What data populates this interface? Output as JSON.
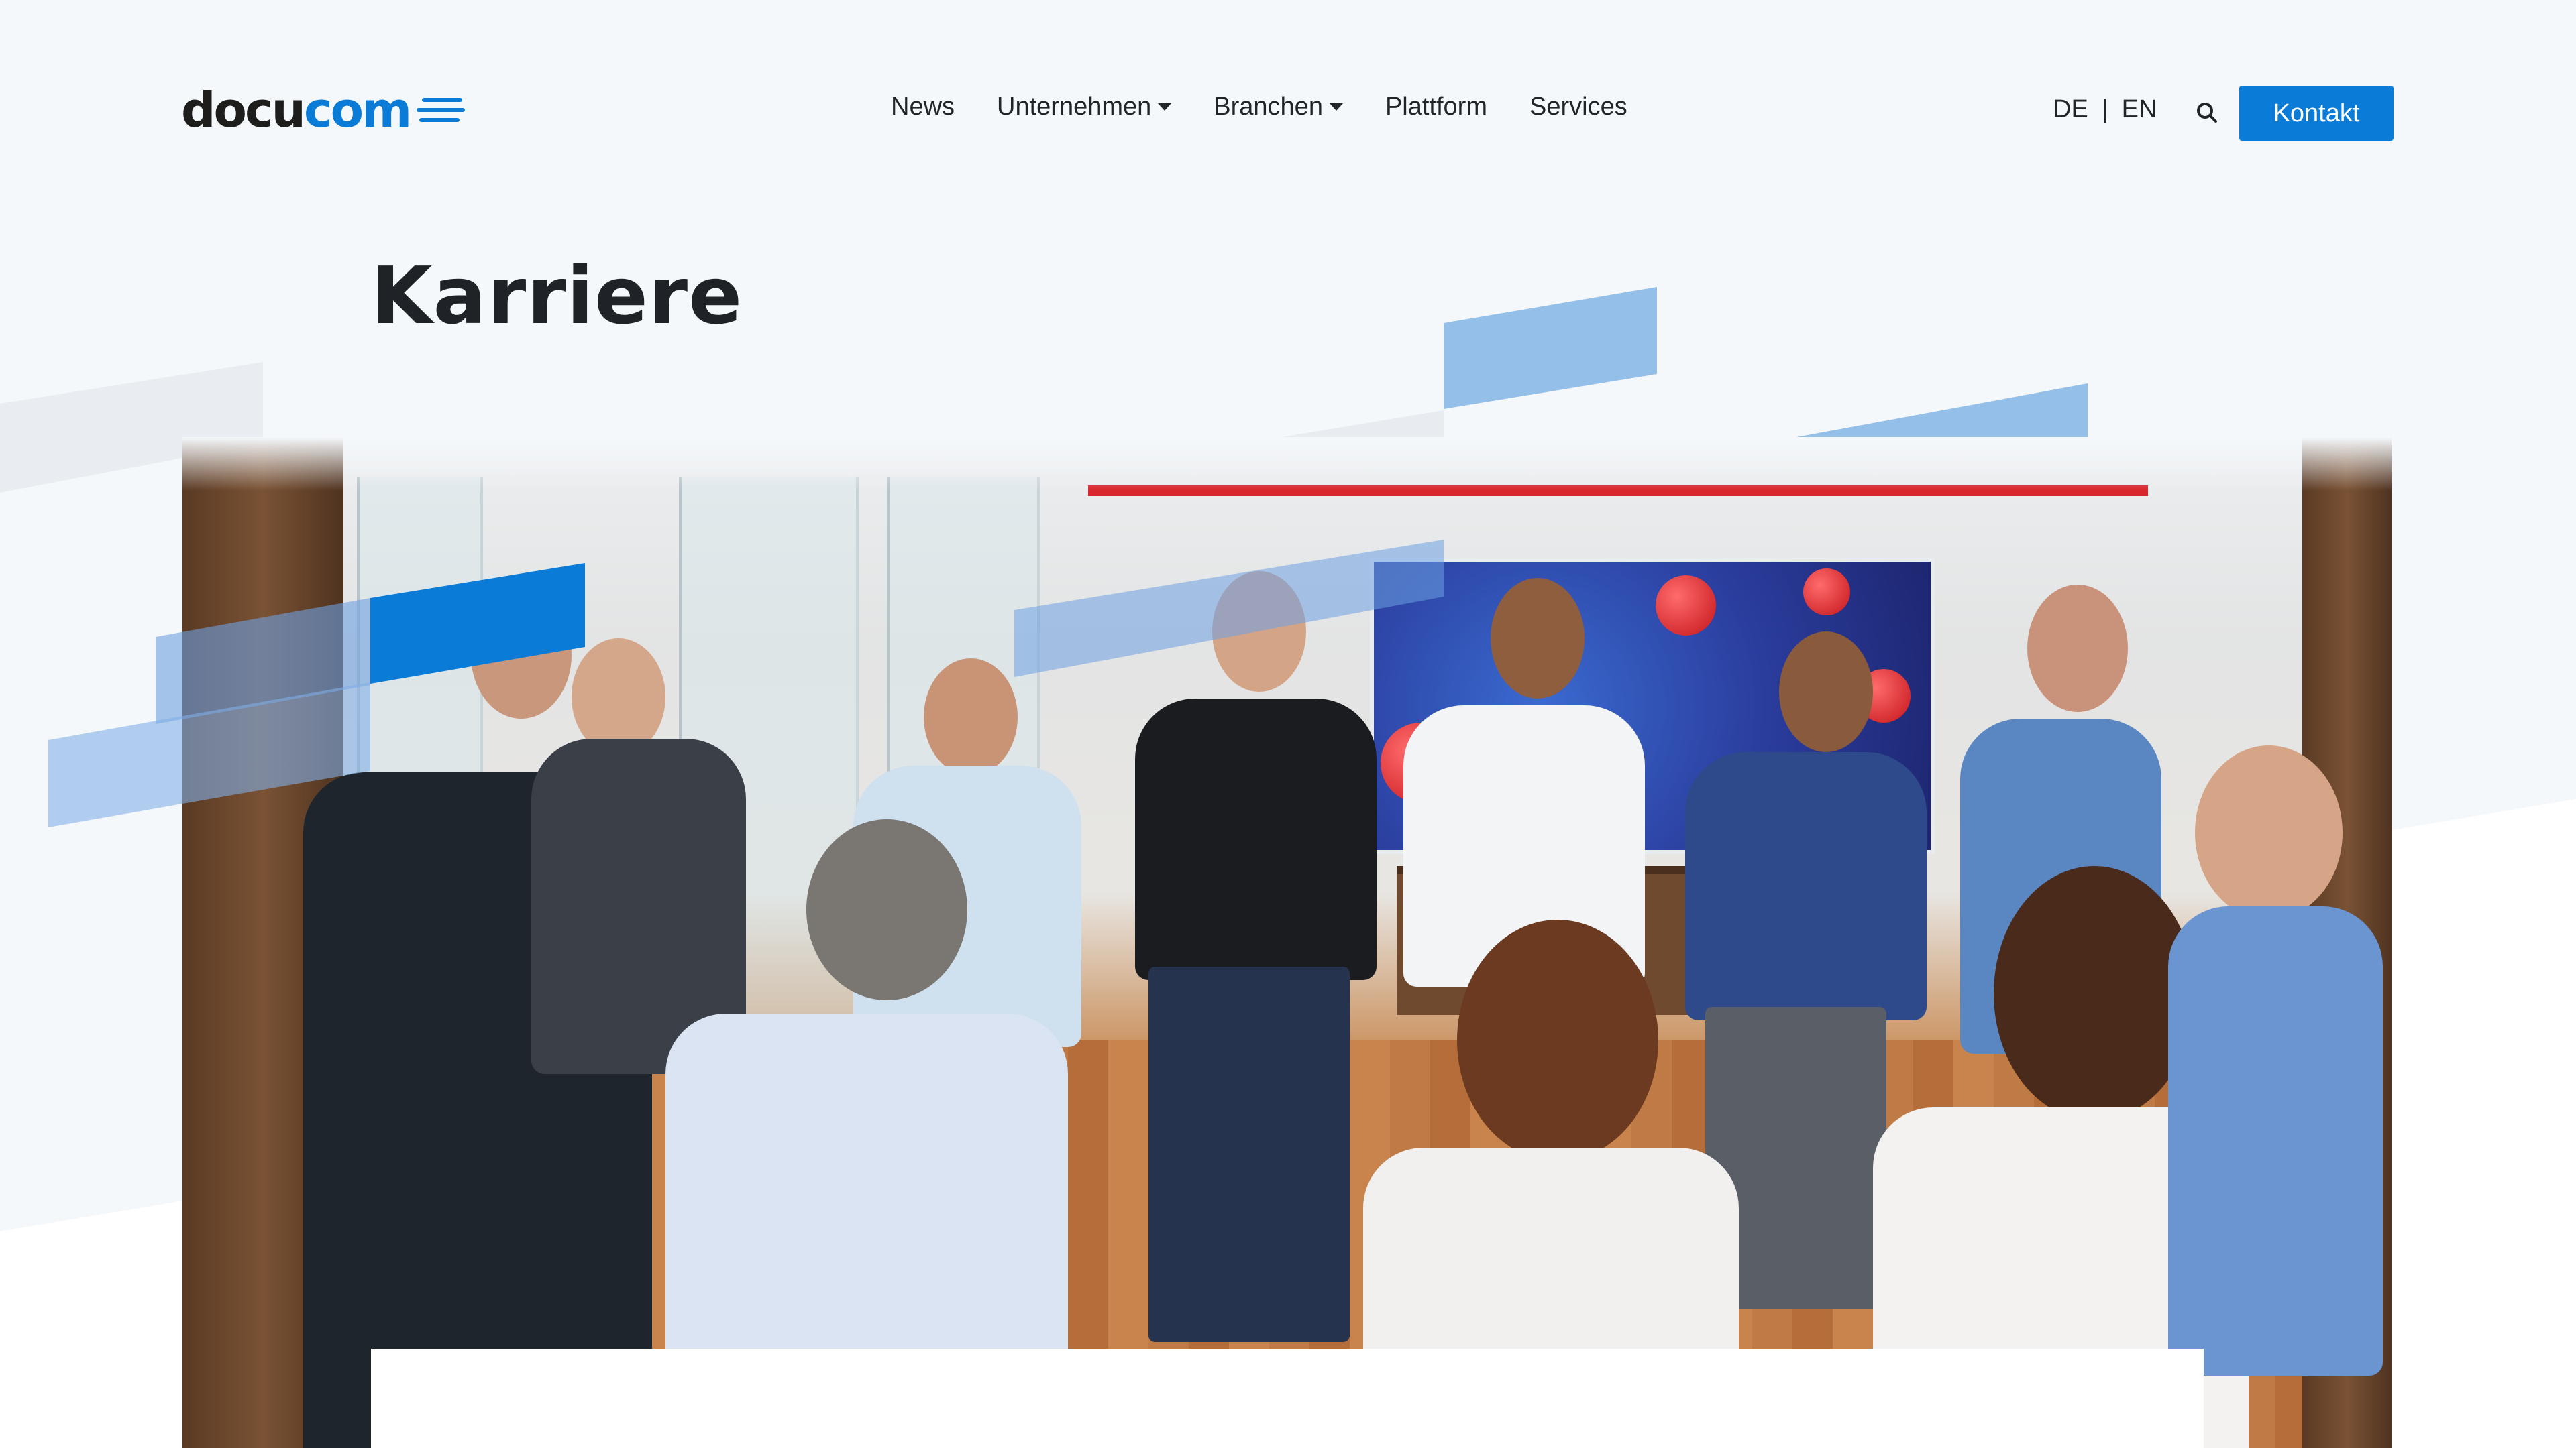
{
  "brand": {
    "logo_docu": "docu",
    "logo_com": "com",
    "accent": "#0a7bd6",
    "dark": "#1d1d1b"
  },
  "nav": {
    "items": [
      {
        "label": "News",
        "dropdown": false
      },
      {
        "label": "Unternehmen",
        "dropdown": true
      },
      {
        "label": "Branchen",
        "dropdown": true
      },
      {
        "label": "Plattform",
        "dropdown": false
      },
      {
        "label": "Services",
        "dropdown": false
      }
    ]
  },
  "lang": {
    "de": "DE",
    "separator": "|",
    "en": "EN"
  },
  "search": {
    "icon": "search-icon"
  },
  "cta": {
    "label": "Kontakt"
  },
  "page": {
    "title": "Karriere"
  },
  "hero": {
    "image": "team-photo"
  }
}
